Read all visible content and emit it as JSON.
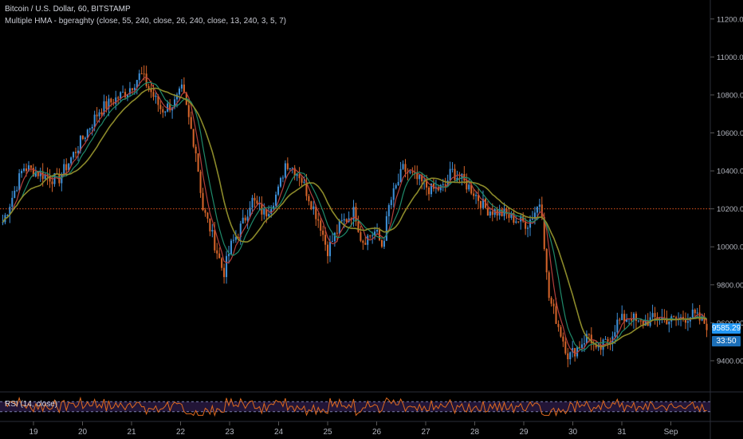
{
  "header": {
    "title": "Bitcoin / U.S. Dollar, 60, BITSTAMP",
    "indicator": "Multiple HMA - bgeraghty (close, 55, 240, close, 26, 240, close, 13, 240, 3, 5, 7)"
  },
  "rsi": {
    "label": "RSI (14, close)",
    "upper": 70,
    "lower": 30
  },
  "price_badge": {
    "value": "9585.29",
    "countdown": "33:50",
    "color": "#2196f3"
  },
  "colors": {
    "background": "#000000",
    "candle_up": "#3d8fd6",
    "candle_down": "#d4642a",
    "hma_fast": "#b5403c",
    "hma_mid": "#1f8a6b",
    "hma_slow": "#8c8a2a",
    "ref_line": "#e0541e",
    "rsi_line": "#e06a1e",
    "rsi_band": "#2a1a45"
  },
  "chart_data": {
    "type": "candlestick",
    "ylim": [
      9240,
      11300
    ],
    "y_ticks": [
      9400,
      9600,
      9800,
      10000,
      10200,
      10400,
      10600,
      10800,
      11000,
      11200
    ],
    "y_tick_labels": [
      "9400.00",
      "9600.00",
      "9800.00",
      "10000.00",
      "10200.00",
      "10400.00",
      "10600.00",
      "10800.00",
      "11000.00",
      "11200.00"
    ],
    "reference_line": 10200,
    "x_ticks": [
      "19",
      "20",
      "21",
      "22",
      "23",
      "24",
      "25",
      "26",
      "27",
      "28",
      "29",
      "30",
      "31",
      "Sep"
    ],
    "price_anchors": [
      [
        0,
        10130
      ],
      [
        3,
        10420
      ],
      [
        8,
        10350
      ],
      [
        14,
        10720
      ],
      [
        18,
        10820
      ],
      [
        20,
        10910
      ],
      [
        23,
        10720
      ],
      [
        25,
        10760
      ],
      [
        26,
        10830
      ],
      [
        28,
        10500
      ],
      [
        29,
        10200
      ],
      [
        30,
        10100
      ],
      [
        32,
        9860
      ],
      [
        33,
        10000
      ],
      [
        35,
        10140
      ],
      [
        36,
        10250
      ],
      [
        38,
        10170
      ],
      [
        40,
        10300
      ],
      [
        41,
        10450
      ],
      [
        43,
        10380
      ],
      [
        46,
        10120
      ],
      [
        47,
        9980
      ],
      [
        49,
        10120
      ],
      [
        51,
        10190
      ],
      [
        52,
        10030
      ],
      [
        54,
        10080
      ],
      [
        55,
        10000
      ],
      [
        56,
        10220
      ],
      [
        58,
        10410
      ],
      [
        62,
        10300
      ],
      [
        64,
        10310
      ],
      [
        65,
        10400
      ],
      [
        68,
        10300
      ],
      [
        70,
        10200
      ],
      [
        72,
        10180
      ],
      [
        74,
        10150
      ],
      [
        76,
        10120
      ],
      [
        77,
        10180
      ],
      [
        78,
        10250
      ],
      [
        79,
        9750
      ],
      [
        80,
        9640
      ],
      [
        82,
        9420
      ],
      [
        83,
        9460
      ],
      [
        85,
        9540
      ],
      [
        86,
        9440
      ],
      [
        88,
        9520
      ],
      [
        89,
        9600
      ],
      [
        91,
        9640
      ],
      [
        92,
        9590
      ],
      [
        95,
        9630
      ],
      [
        97,
        9610
      ],
      [
        100,
        9640
      ],
      [
        102,
        9590
      ]
    ],
    "series": [
      {
        "name": "HMA 13",
        "smoothing": 1
      },
      {
        "name": "HMA 26",
        "smoothing": 3
      },
      {
        "name": "HMA 55",
        "smoothing": 6
      }
    ]
  }
}
